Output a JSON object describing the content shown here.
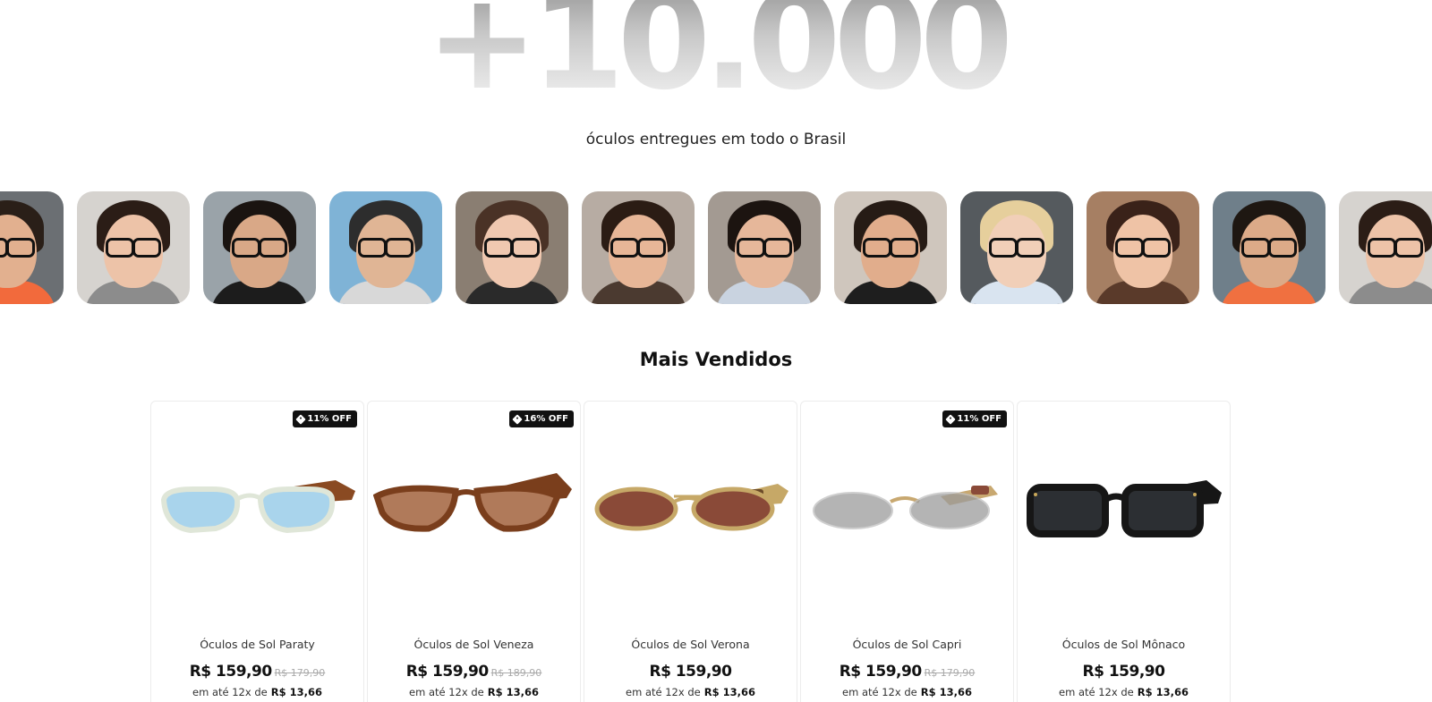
{
  "hero": {
    "number": "+10.000",
    "subtitle": "óculos entregues em todo o Brasil"
  },
  "photos": [
    {
      "hair": "#2a1f18",
      "skin": "#e2b08f",
      "bg": "#6b6f73",
      "shirt": "#f26a3c",
      "glasses": true
    },
    {
      "hair": "#2b1d16",
      "skin": "#edc3a8",
      "bg": "#d6d3cf",
      "shirt": "#8c8c8c",
      "glasses": true
    },
    {
      "hair": "#1a1411",
      "skin": "#d9a887",
      "bg": "#9aa3a9",
      "shirt": "#1c1c1c",
      "glasses": true
    },
    {
      "hair": "#2d2d2d",
      "skin": "#e0b595",
      "bg": "#7fb3d6",
      "shirt": "#d8d8d8",
      "glasses": true
    },
    {
      "hair": "#4a3226",
      "skin": "#f0c8b0",
      "bg": "#8a7e72",
      "shirt": "#2a2a2a",
      "glasses": true
    },
    {
      "hair": "#2b1c14",
      "skin": "#e7b697",
      "bg": "#b7aca3",
      "shirt": "#4b3a30",
      "glasses": true
    },
    {
      "hair": "#1c1410",
      "skin": "#e6b79a",
      "bg": "#a39a92",
      "shirt": "#c9d3e0",
      "glasses": true
    },
    {
      "hair": "#261b15",
      "skin": "#e1ad8c",
      "bg": "#cfc6bd",
      "shirt": "#1e1e1e",
      "glasses": true
    },
    {
      "hair": "#e6cf9c",
      "skin": "#f1cfb8",
      "bg": "#555a5e",
      "shirt": "#d9e4f0",
      "glasses": true
    },
    {
      "hair": "#3a2219",
      "skin": "#efc3a6",
      "bg": "#a67f63",
      "shirt": "#5a3a2a",
      "glasses": true
    },
    {
      "hair": "#1e1712",
      "skin": "#dcaa88",
      "bg": "#6f7f8a",
      "shirt": "#f07040",
      "glasses": true
    },
    {
      "hair": "#2b1d16",
      "skin": "#edc3a8",
      "bg": "#d6d3cf",
      "shirt": "#8c8c8c",
      "glasses": true
    }
  ],
  "section_title": "Mais Vendidos",
  "products": [
    {
      "name": "Óculos de Sol Paraty",
      "badge": "11% OFF",
      "price": "R$ 159,90",
      "old_price": "R$ 179,90",
      "installment_label": "em até 12x de",
      "installment_value": "R$ 13,66",
      "frame_color": "#8a4a22",
      "lens_color": "#a9d4ec",
      "style": "square-clear"
    },
    {
      "name": "Óculos de Sol Veneza",
      "badge": "16% OFF",
      "price": "R$ 159,90",
      "old_price": "R$ 189,90",
      "installment_label": "em até 12x de",
      "installment_value": "R$ 13,66",
      "frame_color": "#7a3e1c",
      "lens_color": "#b07a5a",
      "style": "cat-eye"
    },
    {
      "name": "Óculos de Sol Verona",
      "badge": "",
      "price": "R$ 159,90",
      "old_price": "",
      "installment_label": "em até 12x de",
      "installment_value": "R$ 13,66",
      "frame_color": "#c6a867",
      "lens_color": "#8a4a38",
      "style": "oval-metal"
    },
    {
      "name": "Óculos de Sol Capri",
      "badge": "11% OFF",
      "price": "R$ 159,90",
      "old_price": "R$ 179,90",
      "installment_label": "em até 12x de",
      "installment_value": "R$ 13,66",
      "frame_color": "#c8a870",
      "lens_color": "#9b9b9b",
      "style": "oval-rimless"
    },
    {
      "name": "Óculos de Sol Mônaco",
      "badge": "",
      "price": "R$ 159,90",
      "old_price": "",
      "installment_label": "em até 12x de",
      "installment_value": "R$ 13,66",
      "frame_color": "#161616",
      "lens_color": "#2c2f33",
      "style": "rect-black"
    }
  ]
}
